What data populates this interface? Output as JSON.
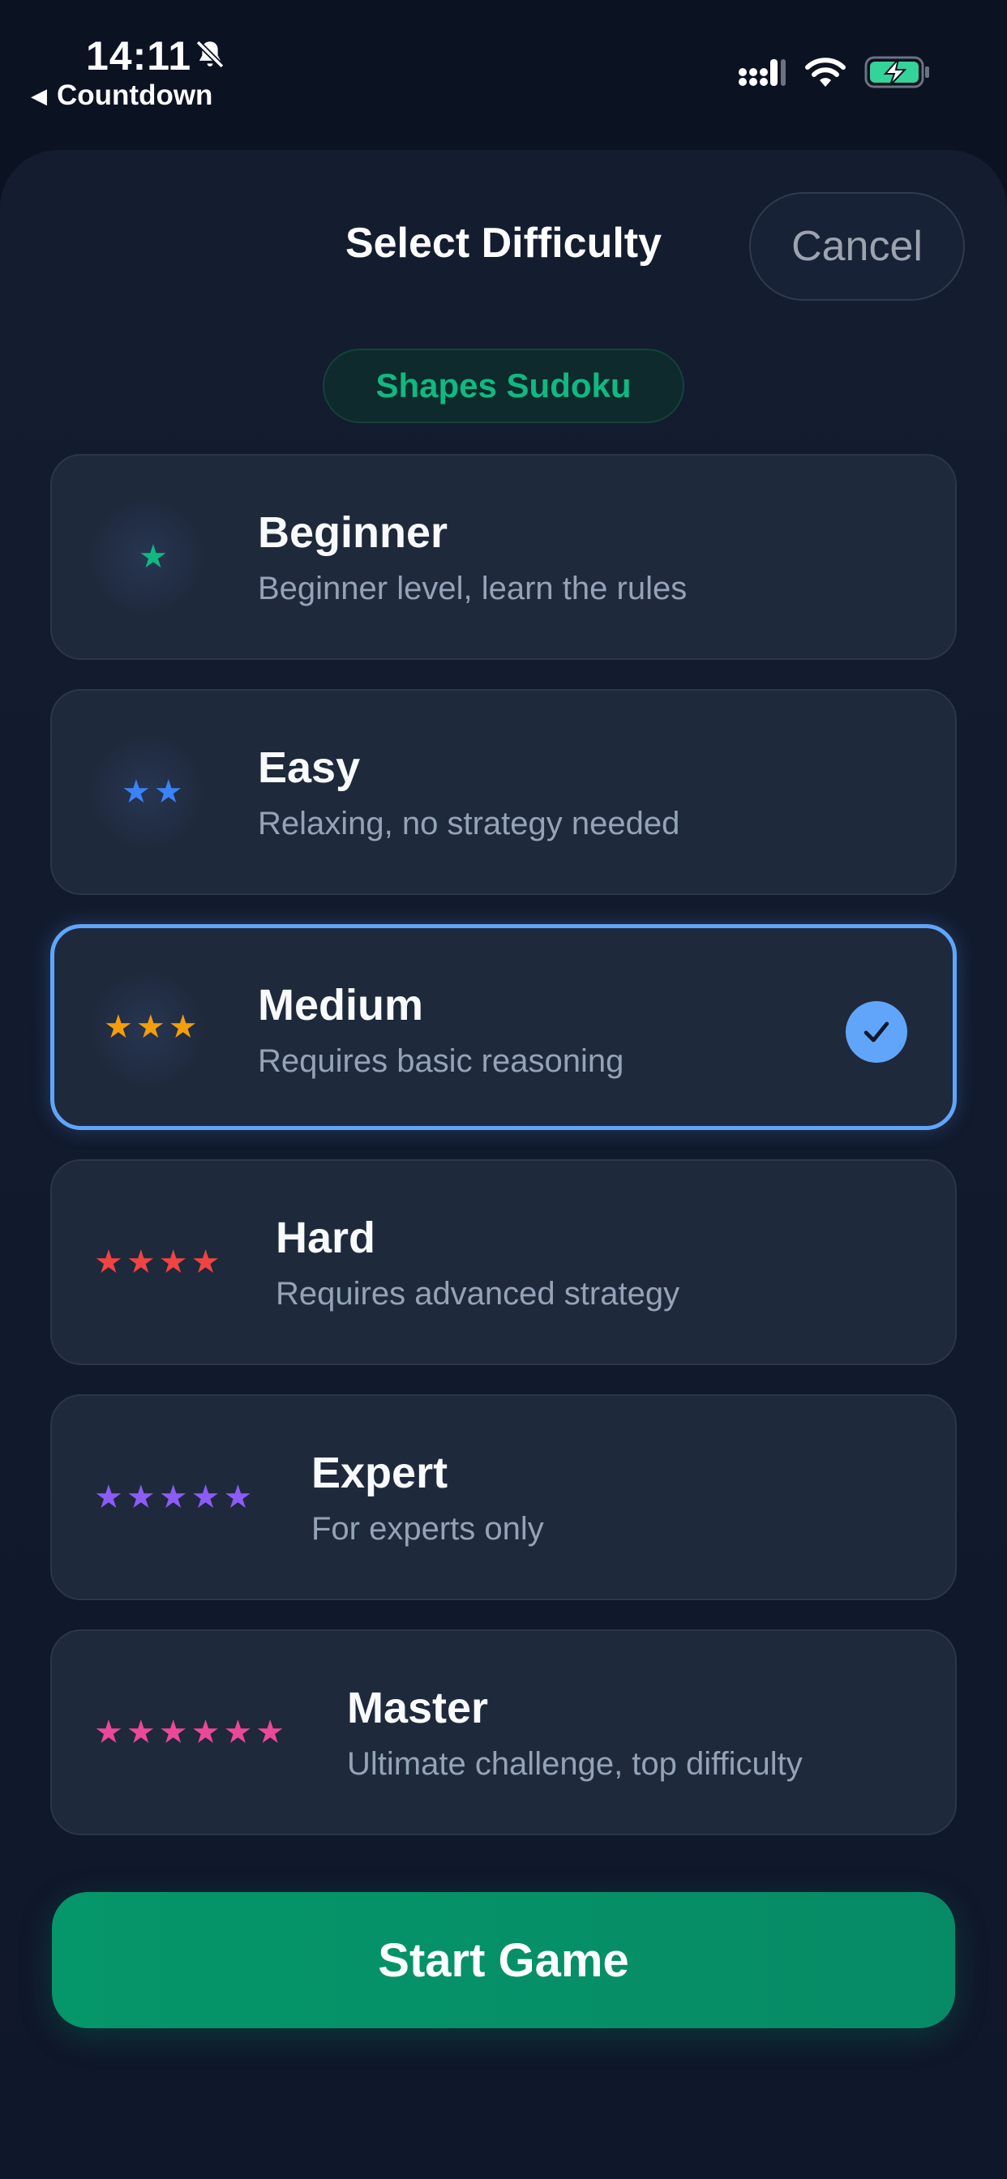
{
  "status_bar": {
    "time": "14:11",
    "back_label": "Countdown",
    "icons": [
      "bell-slash-icon",
      "cellular-signal-icon",
      "wifi-icon",
      "battery-charging-icon"
    ]
  },
  "header": {
    "title": "Select Difficulty",
    "cancel_label": "Cancel",
    "game_tag": "Shapes Sudoku"
  },
  "difficulties": [
    {
      "title": "Beginner",
      "desc": "Beginner level, learn the rules",
      "stars": 1,
      "color": "#10b981",
      "selected": false
    },
    {
      "title": "Easy",
      "desc": "Relaxing, no strategy needed",
      "stars": 2,
      "color": "#3b82f6",
      "selected": false
    },
    {
      "title": "Medium",
      "desc": "Requires basic reasoning",
      "stars": 3,
      "color": "#f59e0b",
      "selected": true
    },
    {
      "title": "Hard",
      "desc": "Requires advanced strategy",
      "stars": 4,
      "color": "#ef4444",
      "selected": false
    },
    {
      "title": "Expert",
      "desc": "For experts only",
      "stars": 5,
      "color": "#8b5cf6",
      "selected": false
    },
    {
      "title": "Master",
      "desc": "Ultimate challenge, top difficulty",
      "stars": 6,
      "color": "#ec4899",
      "selected": false
    }
  ],
  "start_label": "Start Game",
  "colors": {
    "accent_green": "#059669",
    "selection_blue": "#60a5fa",
    "background": "#0b1222",
    "card": "#1e293b"
  }
}
